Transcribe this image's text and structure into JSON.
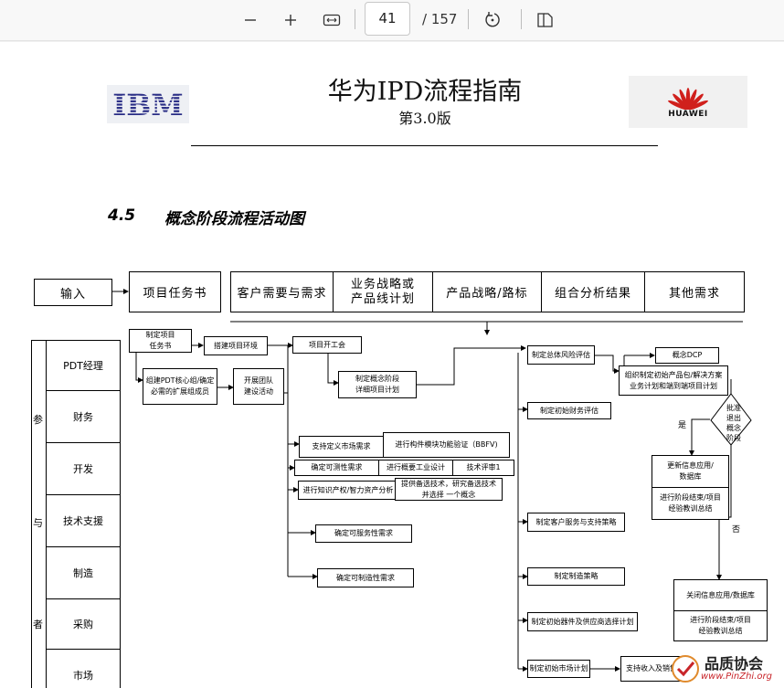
{
  "toolbar": {
    "zoom_out_icon": "minus-icon",
    "zoom_in_icon": "plus-icon",
    "fit_icon": "fit-width-icon",
    "current_page": "41",
    "total_pages": "/ 157",
    "rotate_icon": "rotate-icon",
    "two_page_icon": "two-page-icon"
  },
  "doc": {
    "title": "华为IPD流程指南",
    "version": "第3.0版",
    "ibm_logo": "IBM",
    "huawei_logo": "HUAWEI",
    "section_number": "4.5",
    "section_title": "概念阶段流程活动图"
  },
  "diagram": {
    "input_label": "输入",
    "inputs": [
      "项目任务书",
      "客户需要与需求",
      "业务战略或\n产品线计划",
      "产品战略/路标",
      "组合分析结果",
      "其他需求"
    ],
    "participants_label_chars": [
      "参",
      "与",
      "者"
    ],
    "roles": [
      "PDT经理",
      "财务",
      "开发",
      "技术支援",
      "制造",
      "采购",
      "市场"
    ],
    "activities": {
      "a1": "制定项目\n任务书",
      "a2": "组建PDT核心组/确定\n必需的扩展组成员",
      "a3": "搭建项目环境",
      "a4": "开展团队\n建设活动",
      "a5": "项目开工会",
      "a6": "制定概念阶段\n详细项目计划",
      "a7": "支持定义市场需求",
      "a8": "进行构件模块功能验证（BBFV)",
      "a9": "确定可测性需求",
      "a10": "进行概要工业设计",
      "a11": "技术评审1",
      "a12": "进行知识产权/智力资产分析",
      "a13": "提供备选技术，研究备选技术\n并选择 一个概念",
      "a14": "确定可服务性需求",
      "a15": "确定可制造性需求",
      "a16": "制定总体风险评估",
      "a17": "制定初始财务评估",
      "a18": "制定客户服务与支持策略",
      "a19": "制定制造策略",
      "a20": "制定初始器件及供应商选择计划",
      "a21": "制定初始市场计划",
      "a22": "支持收入及销售",
      "a23": "概念DCP",
      "a24": "组织制定初始产品包/解决方案\n业务计划和端到端项目计划",
      "a25": "批准\n退出\n概念\n阶段",
      "a26": "更新信息应用/\n数据库",
      "a27": "进行阶段结束/项目\n经验教训总结",
      "a28": "关闭信息应用/数据库",
      "a29": "进行阶段结束/项目\n经验教训总结",
      "yes": "是",
      "no": "否"
    }
  },
  "watermark": {
    "brand": "品质协会",
    "url": "www.PinZhi.org"
  }
}
